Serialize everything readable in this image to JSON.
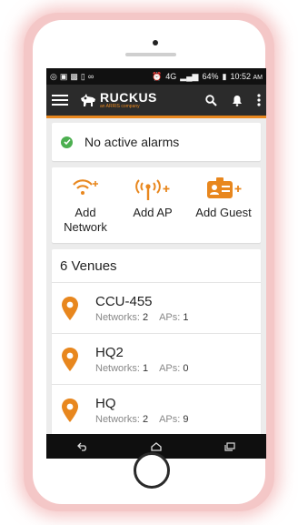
{
  "status_bar": {
    "battery": "64%",
    "time": "10:52",
    "ampm": "AM",
    "network_label": "4G"
  },
  "app_bar": {
    "logo_word": "RUCKUS",
    "logo_sub": "an ARRIS company"
  },
  "alarms": {
    "text": "No active alarms"
  },
  "quick_actions": [
    {
      "label": "Add Network",
      "icon": "wifi-plus-icon"
    },
    {
      "label": "Add AP",
      "icon": "access-point-plus-icon"
    },
    {
      "label": "Add Guest",
      "icon": "guest-badge-plus-icon"
    }
  ],
  "venues": {
    "header": "6 Venues",
    "networks_label": "Networks:",
    "aps_label": "APs:",
    "items": [
      {
        "name": "CCU-455",
        "networks": "2",
        "aps": "1"
      },
      {
        "name": "HQ2",
        "networks": "1",
        "aps": "0"
      },
      {
        "name": "HQ",
        "networks": "2",
        "aps": "9"
      }
    ]
  },
  "colors": {
    "accent": "#e8871e",
    "appbar": "#2b2b2b",
    "success": "#4caf50"
  }
}
